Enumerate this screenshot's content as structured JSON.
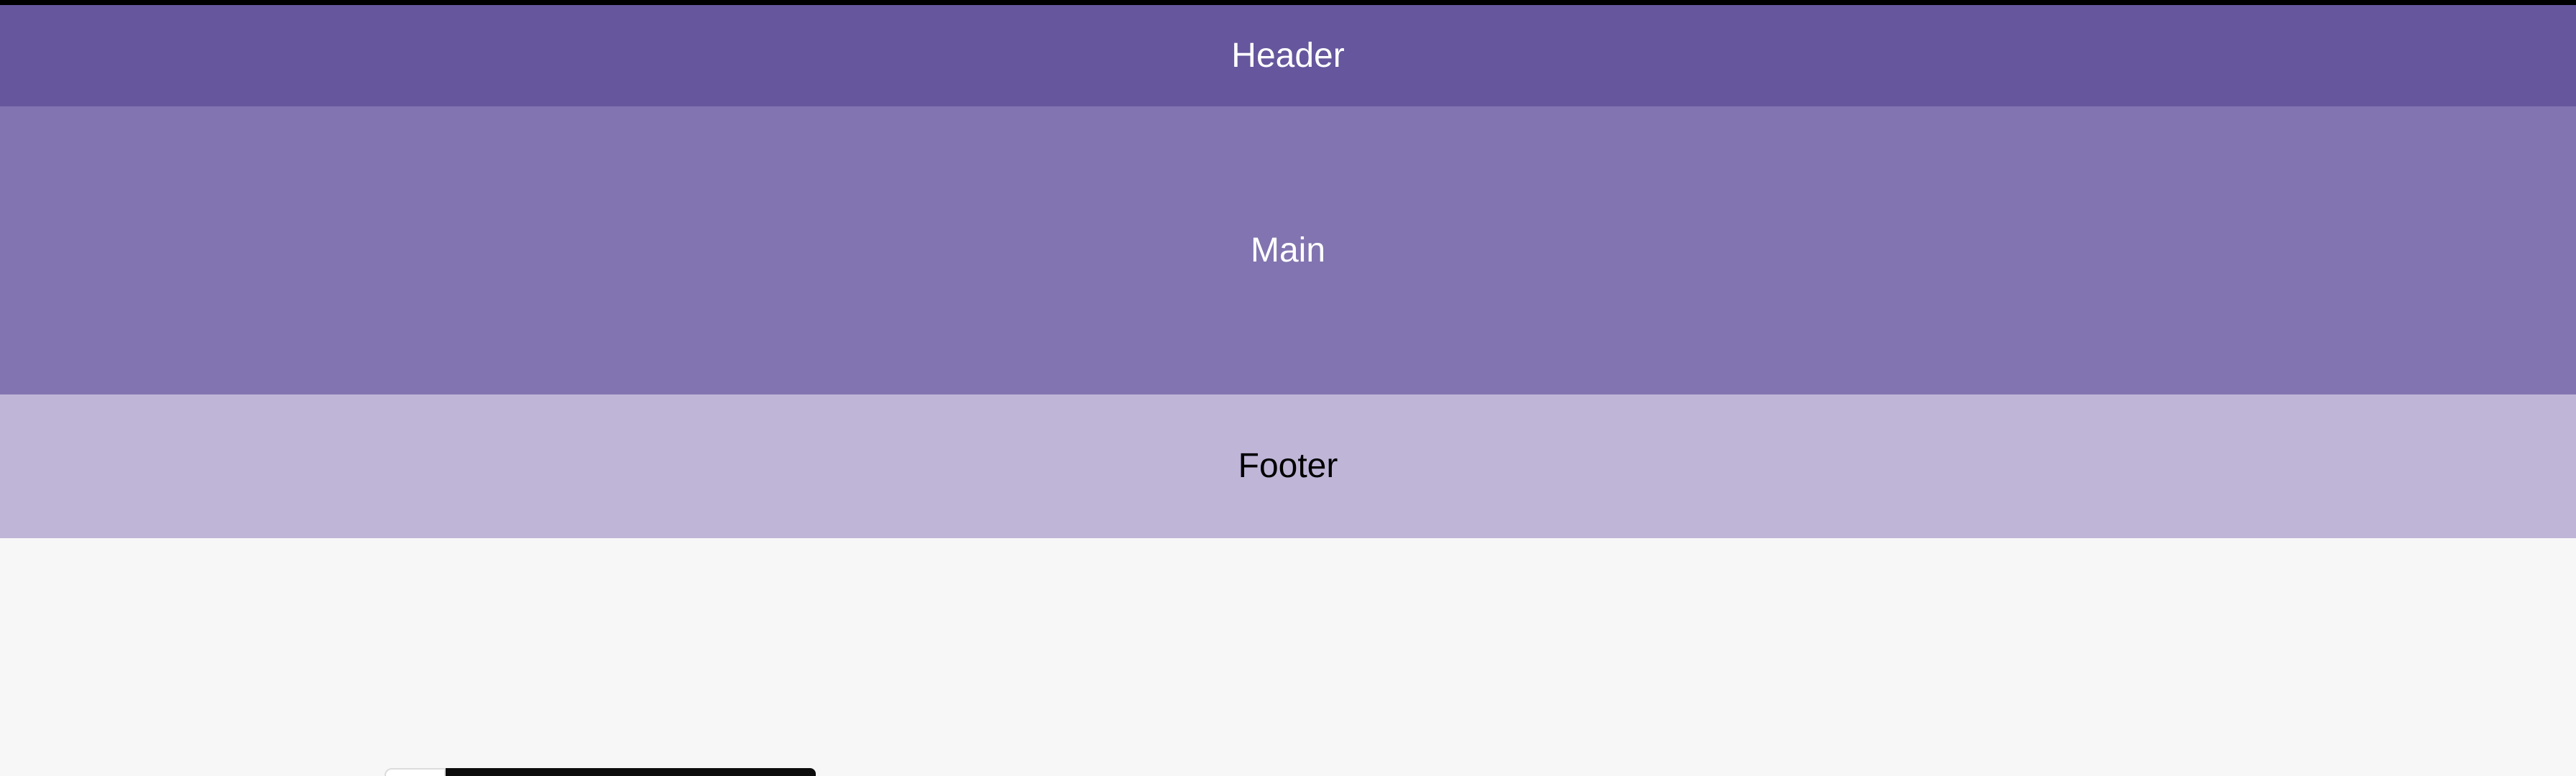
{
  "layout": {
    "header": {
      "label": "Header"
    },
    "main": {
      "label": "Main"
    },
    "footer": {
      "label": "Footer"
    }
  },
  "colors": {
    "header_bg": "#65569d",
    "main_bg": "#8274b0",
    "footer_bg": "#bfb5d7",
    "page_bg": "#f7f7f7",
    "header_text": "#ffffff",
    "main_text": "#ffffff",
    "footer_text": "#000000"
  }
}
